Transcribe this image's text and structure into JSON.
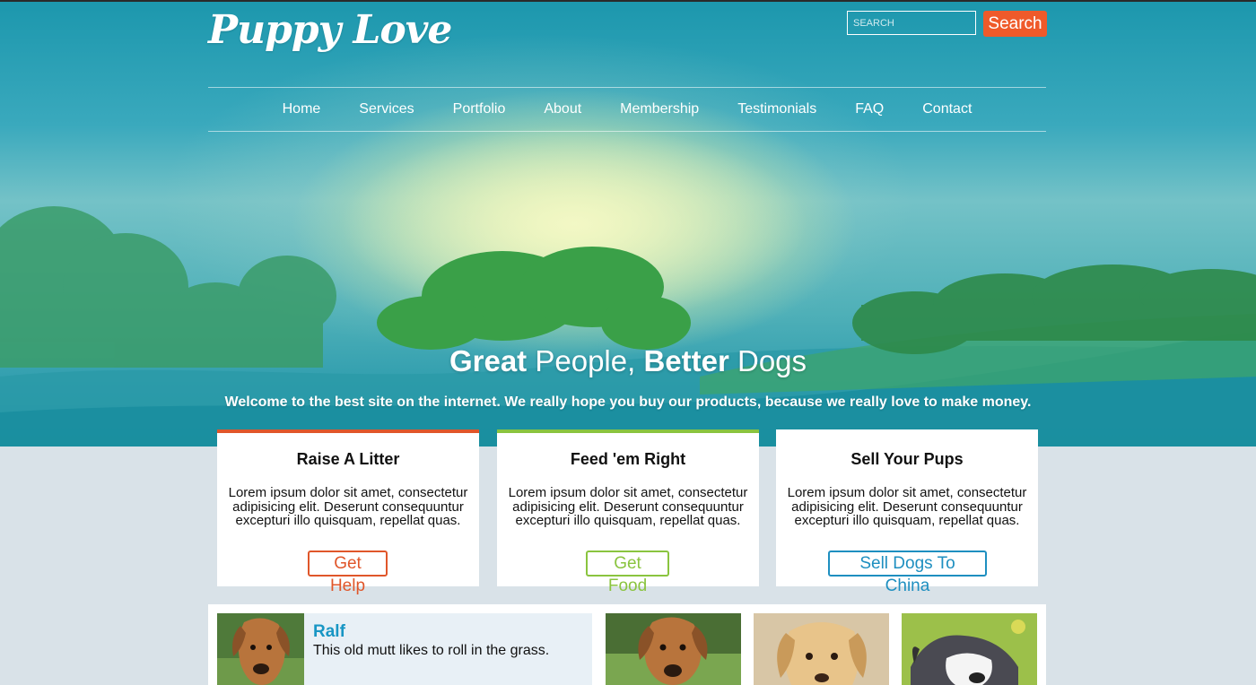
{
  "header": {
    "logo": "Puppy Love",
    "search_placeholder": "SEARCH",
    "search_button": "Search"
  },
  "nav": [
    "Home",
    "Services",
    "Portfolio",
    "About",
    "Membership",
    "Testimonials",
    "FAQ",
    "Contact"
  ],
  "hero": {
    "title_w1": "Great",
    "title_w2": " People, ",
    "title_w3": "Better",
    "title_w4": " Dogs",
    "subtitle": "Welcome to the best site on the internet. We really hope you buy our products, because we really love to make money."
  },
  "cards": [
    {
      "title": "Raise A Litter",
      "text": "Lorem ipsum dolor sit amet, consectetur adipisicing elit. Deserunt consequuntur excepturi illo quisquam, repellat quas.",
      "button": "Get Help",
      "color": "#e0562a"
    },
    {
      "title": "Feed 'em Right",
      "text": "Lorem ipsum dolor sit amet, consectetur adipisicing elit. Deserunt consequuntur excepturi illo quisquam, repellat quas.",
      "button": "Get Food",
      "color": "#8ac43f"
    },
    {
      "title": "Sell Your Pups",
      "text": "Lorem ipsum dolor sit amet, consectetur adipisicing elit. Deserunt consequuntur excepturi illo quisquam, repellat quas.",
      "button": "Sell Dogs To China",
      "color": "#1e8fc0"
    }
  ],
  "featured_dog": {
    "name": "Ralf",
    "description": "This old mutt likes to roll in the grass."
  },
  "colors": {
    "accent_orange": "#ef5a2a",
    "accent_green": "#8ac43f",
    "accent_blue": "#1e8fc0",
    "link_blue": "#1896c4"
  }
}
